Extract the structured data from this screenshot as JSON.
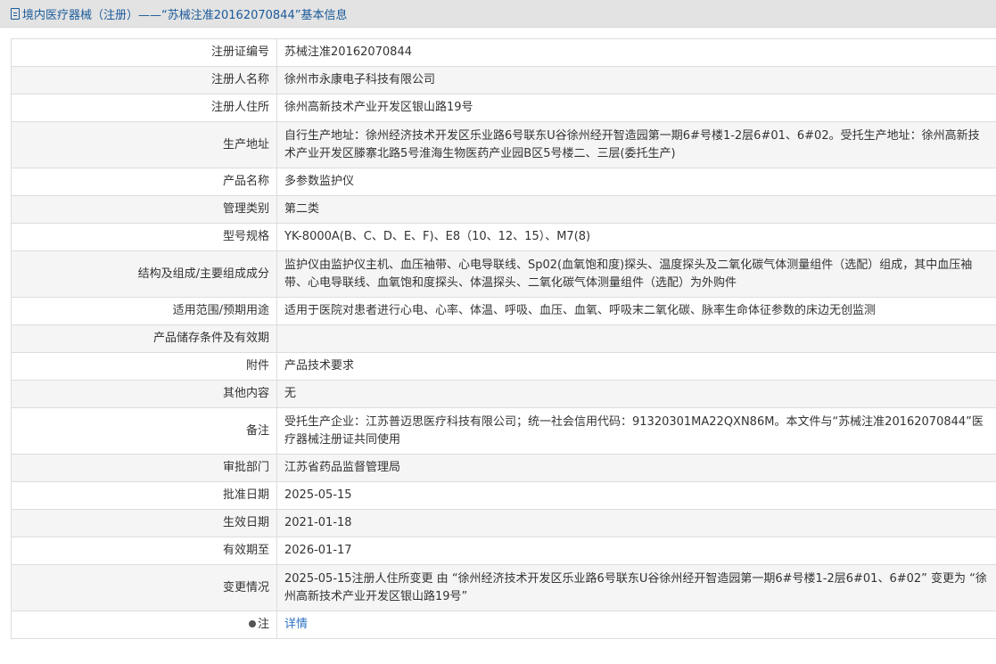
{
  "header": {
    "title": "境内医疗器械（注册）——“苏械注准20162070844”基本信息"
  },
  "rows": [
    {
      "label": "注册证编号",
      "value": "苏械注准20162070844"
    },
    {
      "label": "注册人名称",
      "value": "徐州市永康电子科技有限公司"
    },
    {
      "label": "注册人住所",
      "value": "徐州高新技术产业开发区银山路19号"
    },
    {
      "label": "生产地址",
      "value": "自行生产地址：徐州经济技术开发区乐业路6号联东U谷徐州经开智造园第一期6#号楼1-2层6#01、6#02。受托生产地址：徐州高新技术产业开发区滕寨北路5号淮海生物医药产业园B区5号楼二、三层(委托生产)"
    },
    {
      "label": "产品名称",
      "value": "多参数监护仪"
    },
    {
      "label": "管理类别",
      "value": "第二类"
    },
    {
      "label": "型号规格",
      "value": "YK-8000A(B、C、D、E、F)、E8（10、12、15）、M7(8)"
    },
    {
      "label": "结构及组成/主要组成成分",
      "value": "监护仪由监护仪主机、血压袖带、心电导联线、Sp02(血氧饱和度)探头、温度探头及二氧化碳气体测量组件（选配）组成，其中血压袖带、心电导联线、血氧饱和度探头、体温探头、二氧化碳气体测量组件（选配）为外购件"
    },
    {
      "label": "适用范围/预期用途",
      "value": "适用于医院对患者进行心电、心率、体温、呼吸、血压、血氧、呼吸末二氧化碳、脉率生命体征参数的床边无创监测"
    },
    {
      "label": "产品储存条件及有效期",
      "value": ""
    },
    {
      "label": "附件",
      "value": "产品技术要求"
    },
    {
      "label": "其他内容",
      "value": "无"
    },
    {
      "label": "备注",
      "value": "受托生产企业：江苏普迈思医疗科技有限公司；统一社会信用代码：91320301MA22QXN86M。本文件与“苏械注准20162070844”医疗器械注册证共同使用"
    },
    {
      "label": "审批部门",
      "value": "江苏省药品监督管理局"
    },
    {
      "label": "批准日期",
      "value": "2025-05-15"
    },
    {
      "label": "生效日期",
      "value": "2021-01-18"
    },
    {
      "label": "有效期至",
      "value": "2026-01-17"
    },
    {
      "label": "变更情况",
      "value": "2025-05-15注册人住所变更 由 “徐州经济技术开发区乐业路6号联东U谷徐州经开智造园第一期6#号楼1-2层6#01、6#02” 变更为 “徐州高新技术产业开发区银山路19号”"
    },
    {
      "label": "注",
      "value": "详情"
    }
  ]
}
